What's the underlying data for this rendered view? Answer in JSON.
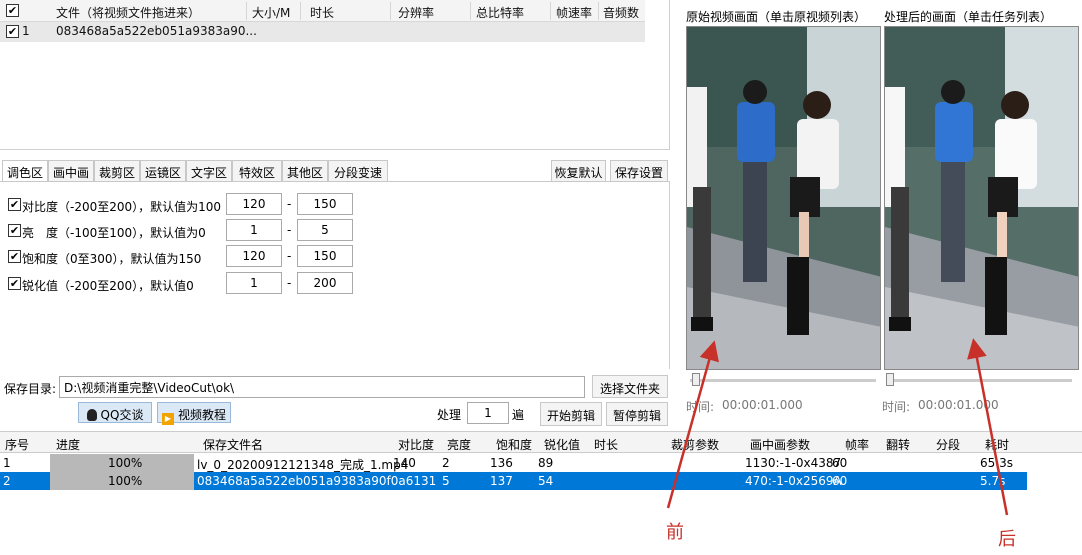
{
  "file_list": {
    "headers": [
      "文件（将视频文件拖进来）",
      "大小/M",
      "时长",
      "分辨率",
      "总比特率",
      "帧速率",
      "音频数"
    ],
    "rows": [
      {
        "index": "1",
        "name": "083468a5a522eb051a9383a90...",
        "checked": true
      }
    ]
  },
  "tabs": [
    "调色区",
    "画中画",
    "裁剪区",
    "运镜区",
    "文字区",
    "特效区",
    "其他区",
    "分段变速"
  ],
  "top_buttons": {
    "restore": "恢复默认",
    "save_settings": "保存设置"
  },
  "params": [
    {
      "label": "对比度（-200至200），默认值为100",
      "from": "120",
      "to": "150",
      "checked": true
    },
    {
      "label": "亮　度（-100至100），默认值为0",
      "from": "1",
      "to": "5",
      "checked": true
    },
    {
      "label": "饱和度（0至300），默认值为150",
      "from": "120",
      "to": "150",
      "checked": true
    },
    {
      "label": "锐化值（-200至200），默认值0",
      "from": "1",
      "to": "200",
      "checked": true
    }
  ],
  "save": {
    "label": "保存目录:",
    "path": "D:\\视频消重完整\\VideoCut\\ok\\",
    "choose_folder": "选择文件夹"
  },
  "actions": {
    "qq": "QQ交谈",
    "tutorial": "视频教程",
    "process_label": "处理",
    "process_count": "1",
    "times_label": "遍",
    "start": "开始剪辑",
    "pause": "暂停剪辑"
  },
  "task_table": {
    "headers": [
      "序号",
      "进度",
      "保存文件名",
      "对比度",
      "亮度",
      "饱和度",
      "锐化值",
      "时长",
      "裁剪参数",
      "画中画参数",
      "帧率",
      "翻转",
      "分段",
      "耗时"
    ],
    "rows": [
      {
        "index": "1",
        "progress": "100%",
        "progress_value": 1.0,
        "filename": "lv_0_20200912121348_完成_1.mp4",
        "contrast": "140",
        "brightness": "2",
        "saturation": "136",
        "sharpen": "89",
        "pip": "1130:-1-0x4387",
        "fps": "60",
        "elapsed": "65.3s",
        "selected": false
      },
      {
        "index": "2",
        "progress": "100%",
        "progress_value": 1.0,
        "filename": "083468a5a522eb051a9383a90f0a6131",
        "contrast": "5",
        "brightness": "137",
        "saturation": "54",
        "sharpen": "",
        "pip": "470:-1-0x2569A",
        "fps": "60",
        "elapsed": "5.7s",
        "selected": true
      }
    ]
  },
  "preview": {
    "original_title": "原始视频画面（单击原视频列表）",
    "processed_title": "处理后的画面（单击任务列表）",
    "time_label": "时间:",
    "original_time": "00:00:01.000",
    "processed_time": "00:00:01.000"
  },
  "annotations": {
    "before": "前",
    "after": "后"
  },
  "colors": {
    "selection": "#0078d7",
    "annotation": "#c8302a",
    "progress": "#b8b8b8"
  }
}
